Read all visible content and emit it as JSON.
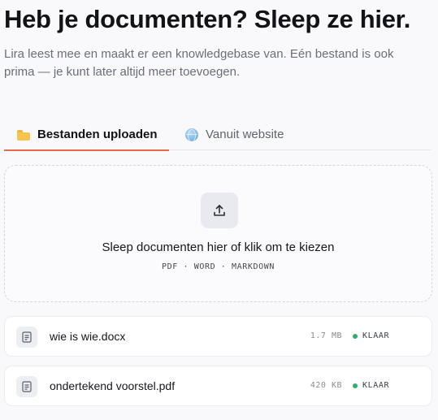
{
  "header": {
    "title": "Heb je documenten? Sleep ze hier.",
    "subtitle": "Lira leest mee en maakt er een knowledgebase van. Eén bestand is ook prima — je kunt later altijd meer toevoegen."
  },
  "tabs": [
    {
      "label": "Bestanden uploaden",
      "icon": "folder-icon",
      "active": true
    },
    {
      "label": "Vanuit website",
      "icon": "globe-icon",
      "active": false
    }
  ],
  "dropzone": {
    "icon": "upload-icon",
    "title": "Sleep documenten hier of klik om te kiezen",
    "formats": "PDF · WORD · MARKDOWN"
  },
  "files": [
    {
      "name": "wie is wie.docx",
      "size": "1.7 MB",
      "status": "KLAAR",
      "icon": "document-icon"
    },
    {
      "name": "ondertekend voorstel.pdf",
      "size": "420 KB",
      "status": "KLAAR",
      "icon": "document-icon"
    }
  ],
  "colors": {
    "accent": "#e86a4a",
    "status_ready": "#2fae6e"
  }
}
